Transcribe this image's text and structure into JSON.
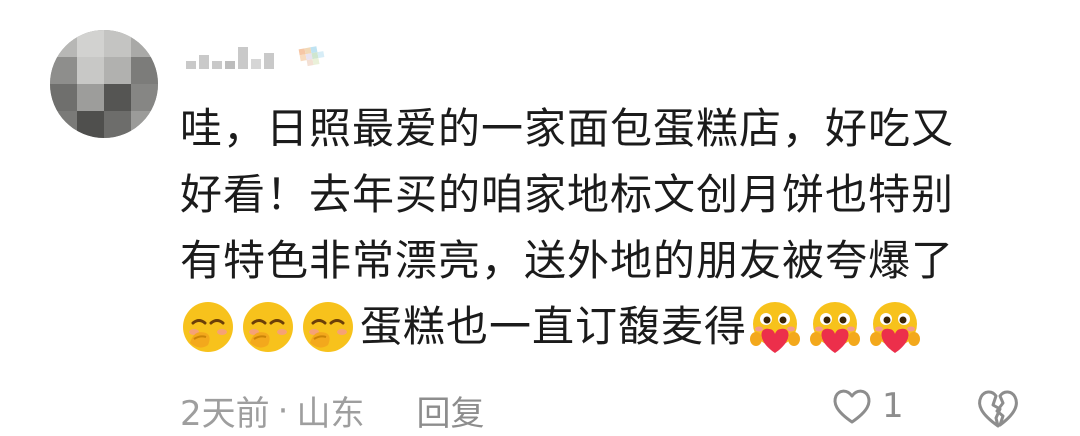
{
  "comment": {
    "lines": [
      "哇，日照最爱的一家面包蛋糕店，好吃又",
      "好看！去年买的咱家地标文创月饼也特别",
      "有特色非常漂亮，送外地的朋友被夸爆了"
    ],
    "last_line_text": "蛋糕也一直订馥麦得",
    "emojis_before": [
      "giggle-face-icon",
      "giggle-face-icon",
      "giggle-face-icon"
    ],
    "emojis_after": [
      "heart-hug-face-icon",
      "heart-hug-face-icon",
      "heart-hug-face-icon"
    ]
  },
  "meta": {
    "time": "2天前",
    "separator": "·",
    "location": "山东",
    "reply_label": "回复"
  },
  "actions": {
    "like_icon": "heart-outline-icon",
    "like_count": "1",
    "dislike_icon": "broken-heart-icon"
  },
  "colors": {
    "text": "#1b1b1b",
    "meta": "#9e9e9e",
    "emoji_face": "#f7c21c",
    "emoji_heart": "#ec2f4b"
  }
}
